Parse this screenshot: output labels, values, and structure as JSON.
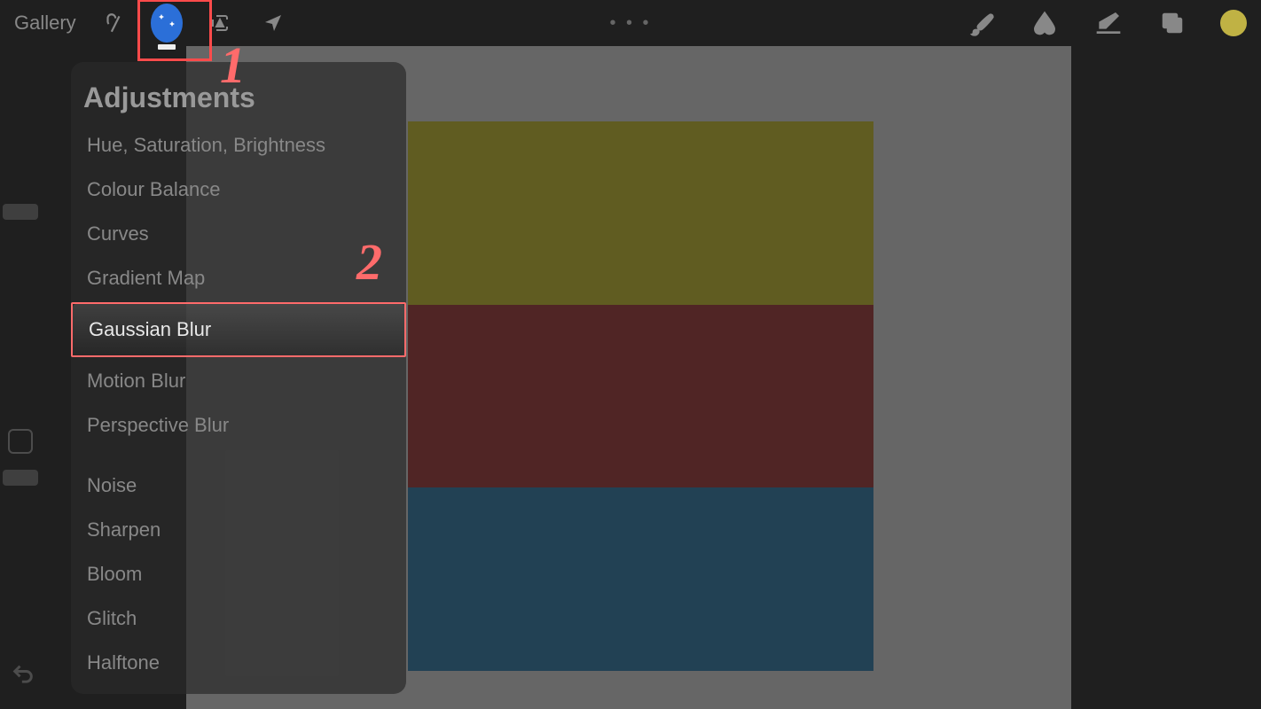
{
  "toolbar": {
    "gallery_label": "Gallery",
    "center_ellipsis": "• • •",
    "color_swatch_hex": "#c0b244"
  },
  "annotations": {
    "label_1": "1",
    "label_2": "2"
  },
  "adjustments_menu": {
    "title": "Adjustments",
    "items": {
      "hsb": "Hue, Saturation, Brightness",
      "colour_balance": "Colour Balance",
      "curves": "Curves",
      "gradient_map": "Gradient Map",
      "gaussian_blur": "Gaussian Blur",
      "motion_blur": "Motion Blur",
      "perspective_blur": "Perspective Blur",
      "noise": "Noise",
      "sharpen": "Sharpen",
      "bloom": "Bloom",
      "glitch": "Glitch",
      "halftone": "Halftone"
    },
    "highlighted_item": "gaussian_blur"
  },
  "canvas": {
    "stripes": [
      "#817b2d",
      "#6b3232",
      "#2e5770"
    ]
  }
}
